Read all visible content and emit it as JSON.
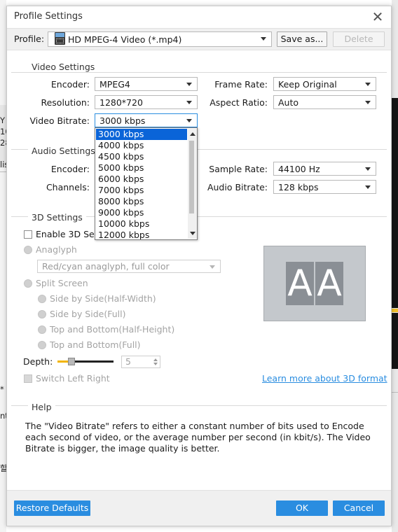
{
  "window": {
    "title": "Profile Settings"
  },
  "profile": {
    "label": "Profile:",
    "selected": "HD MPEG-4 Video (*.mp4)",
    "save_as": "Save as...",
    "delete": "Delete"
  },
  "video": {
    "group_title": "Video Settings",
    "encoder_label": "Encoder:",
    "encoder_value": "MPEG4",
    "resolution_label": "Resolution:",
    "resolution_value": "1280*720",
    "bitrate_label": "Video Bitrate:",
    "bitrate_value": "3000 kbps",
    "framerate_label": "Frame Rate:",
    "framerate_value": "Keep Original",
    "aspect_label": "Aspect Ratio:",
    "aspect_value": "Auto",
    "bitrate_options": [
      "3000 kbps",
      "4000 kbps",
      "4500 kbps",
      "5000 kbps",
      "6000 kbps",
      "7000 kbps",
      "8000 kbps",
      "9000 kbps",
      "10000 kbps",
      "12000 kbps"
    ]
  },
  "audio": {
    "group_title": "Audio Settings",
    "encoder_label": "Encoder:",
    "channels_label": "Channels:",
    "samplerate_label": "Sample Rate:",
    "samplerate_value": "44100 Hz",
    "bitrate_label": "Audio Bitrate:",
    "bitrate_value": "128 kbps"
  },
  "settings3d": {
    "group_title": "3D Settings",
    "enable_label": "Enable 3D Settings",
    "anaglyph_label": "Anaglyph",
    "anaglyph_value": "Red/cyan anaglyph, full color",
    "split_label": "Split Screen",
    "sbs_half": "Side by Side(Half-Width)",
    "sbs_full": "Side by Side(Full)",
    "tb_half": "Top and Bottom(Half-Height)",
    "tb_full": "Top and Bottom(Full)",
    "depth_label": "Depth:",
    "depth_value": "5",
    "depth_level": 0.25,
    "switch_label": "Switch Left Right",
    "learn_more": "Learn more about 3D format",
    "preview_letters": [
      "A",
      "A"
    ]
  },
  "help": {
    "group_title": "Help",
    "text": "The \"Video Bitrate\" refers to either a constant number of bits used to Encode each second of video, or the average number per second (in kbit/s). The Video Bitrate is bigger, the image quality is better."
  },
  "footer": {
    "restore": "Restore Defaults",
    "ok": "OK",
    "cancel": "Cancel"
  },
  "background": {
    "left_fragments": [
      "Y",
      "10",
      "28",
      "lis",
      "*",
      "nt",
      "할"
    ]
  },
  "colors": {
    "accent": "#2a8de0",
    "selection": "#0a64d8",
    "slider": "#f2b400"
  },
  "icons": {
    "format": "video-format-icon",
    "close": "close-icon",
    "dropdown": "chevron-down-icon"
  }
}
